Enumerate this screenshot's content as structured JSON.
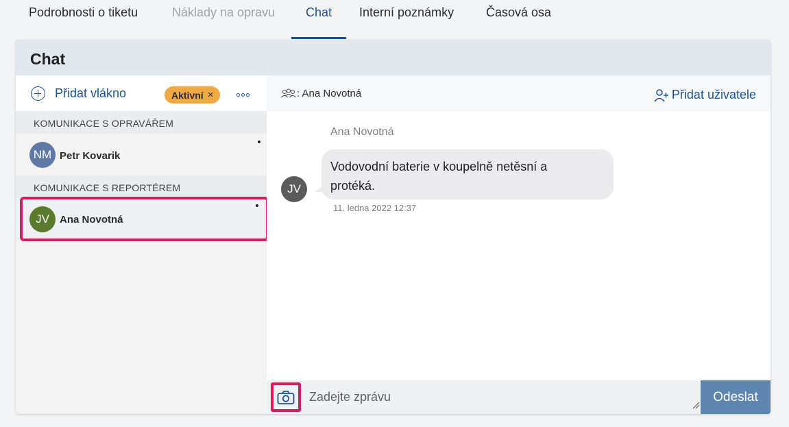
{
  "tabs": [
    {
      "label": "Podrobnosti o tiketu",
      "state": "normal"
    },
    {
      "label": "Náklady na opravu",
      "state": "disabled"
    },
    {
      "label": "Chat",
      "state": "active"
    },
    {
      "label": "Interní poznámky",
      "state": "normal"
    },
    {
      "label": "Časová osa",
      "state": "normal"
    }
  ],
  "card": {
    "title": "Chat"
  },
  "threads_panel": {
    "add_thread_label": "Přidat vlákno",
    "filter_chip": {
      "label": "Aktivní",
      "close": "×",
      "color": "#f0a942"
    },
    "more_icon": "more-horizontal-icon",
    "groups": [
      {
        "label": "KOMUNIKACE S OPRAVÁŘEM",
        "threads": [
          {
            "initials": "NM",
            "name": "Petr Kovarik",
            "avatar_color": "#5f7aa6",
            "unread": true,
            "selected": false
          }
        ]
      },
      {
        "label": "KOMUNIKACE S REPORTÉREM",
        "threads": [
          {
            "initials": "JV",
            "name": "Ana Novotná",
            "avatar_color": "#5a7a2e",
            "unread": true,
            "selected": true
          }
        ]
      }
    ]
  },
  "conversation": {
    "participants_label": ": Ana Novotná",
    "add_users_label": "Přidat uživatele",
    "messages": [
      {
        "author": "Ana Novotná",
        "initials": "JV",
        "text_line1": "Vodovodní baterie v koupelně netěsní a",
        "text_line2": "protéká.",
        "time": "11. ledna 2022 12:37"
      }
    ],
    "composer": {
      "placeholder": "Zadejte zprávu",
      "send_label": "Odeslat"
    }
  },
  "colors": {
    "accent": "#1b5296",
    "highlight": "#d91b5c",
    "send_button": "#5e84b0"
  }
}
